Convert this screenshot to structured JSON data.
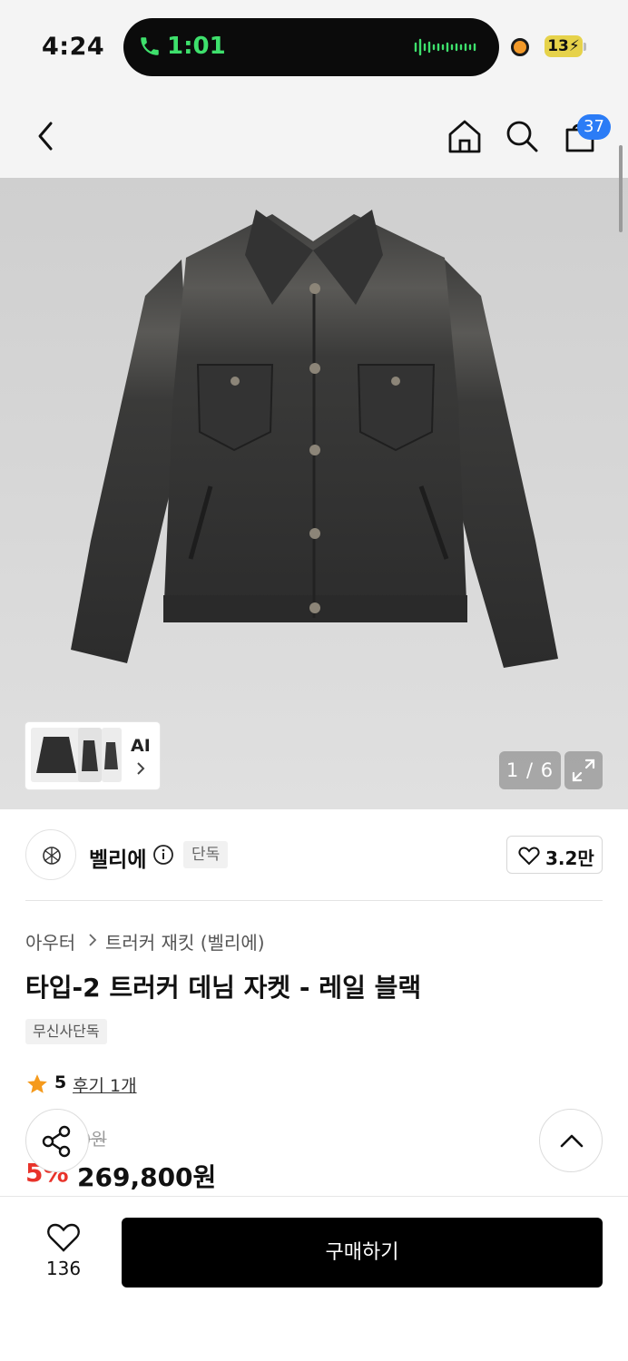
{
  "status_bar": {
    "time": "4:24",
    "call_timer": "1:01",
    "battery": "13",
    "icons": [
      "phone-icon",
      "audio-wave-icon",
      "recording-dot-icon",
      "battery-charging-icon"
    ]
  },
  "header": {
    "icons": [
      "back-arrow-icon",
      "home-icon",
      "search-icon",
      "shopping-bag-icon"
    ],
    "cart_count": "37"
  },
  "gallery": {
    "ai_label": "AI",
    "counter": "1 / 6",
    "image_subject": "dark washed denim trucker jacket"
  },
  "brand": {
    "name": "벨리에",
    "exclusive_tag": "단독",
    "likes": "3.2만"
  },
  "product": {
    "category": "아우터",
    "subcategory": "트러커 재킷 (벨리에)",
    "title": "타입-2 트러커 데님 자켓 - 레일 블랙",
    "exclusive_badge": "무신사단독",
    "rating": "5",
    "reviews": "후기 1개",
    "original_price_visible": "0원",
    "discount": "5%",
    "price": "269,800원"
  },
  "bottom_bar": {
    "favorite_count": "136",
    "buy_label": "구매하기"
  },
  "colors": {
    "accent_blue": "#2b7cf6",
    "discount_red": "#e8332a",
    "call_green": "#3ee06c",
    "star_orange": "#f59a1c"
  }
}
